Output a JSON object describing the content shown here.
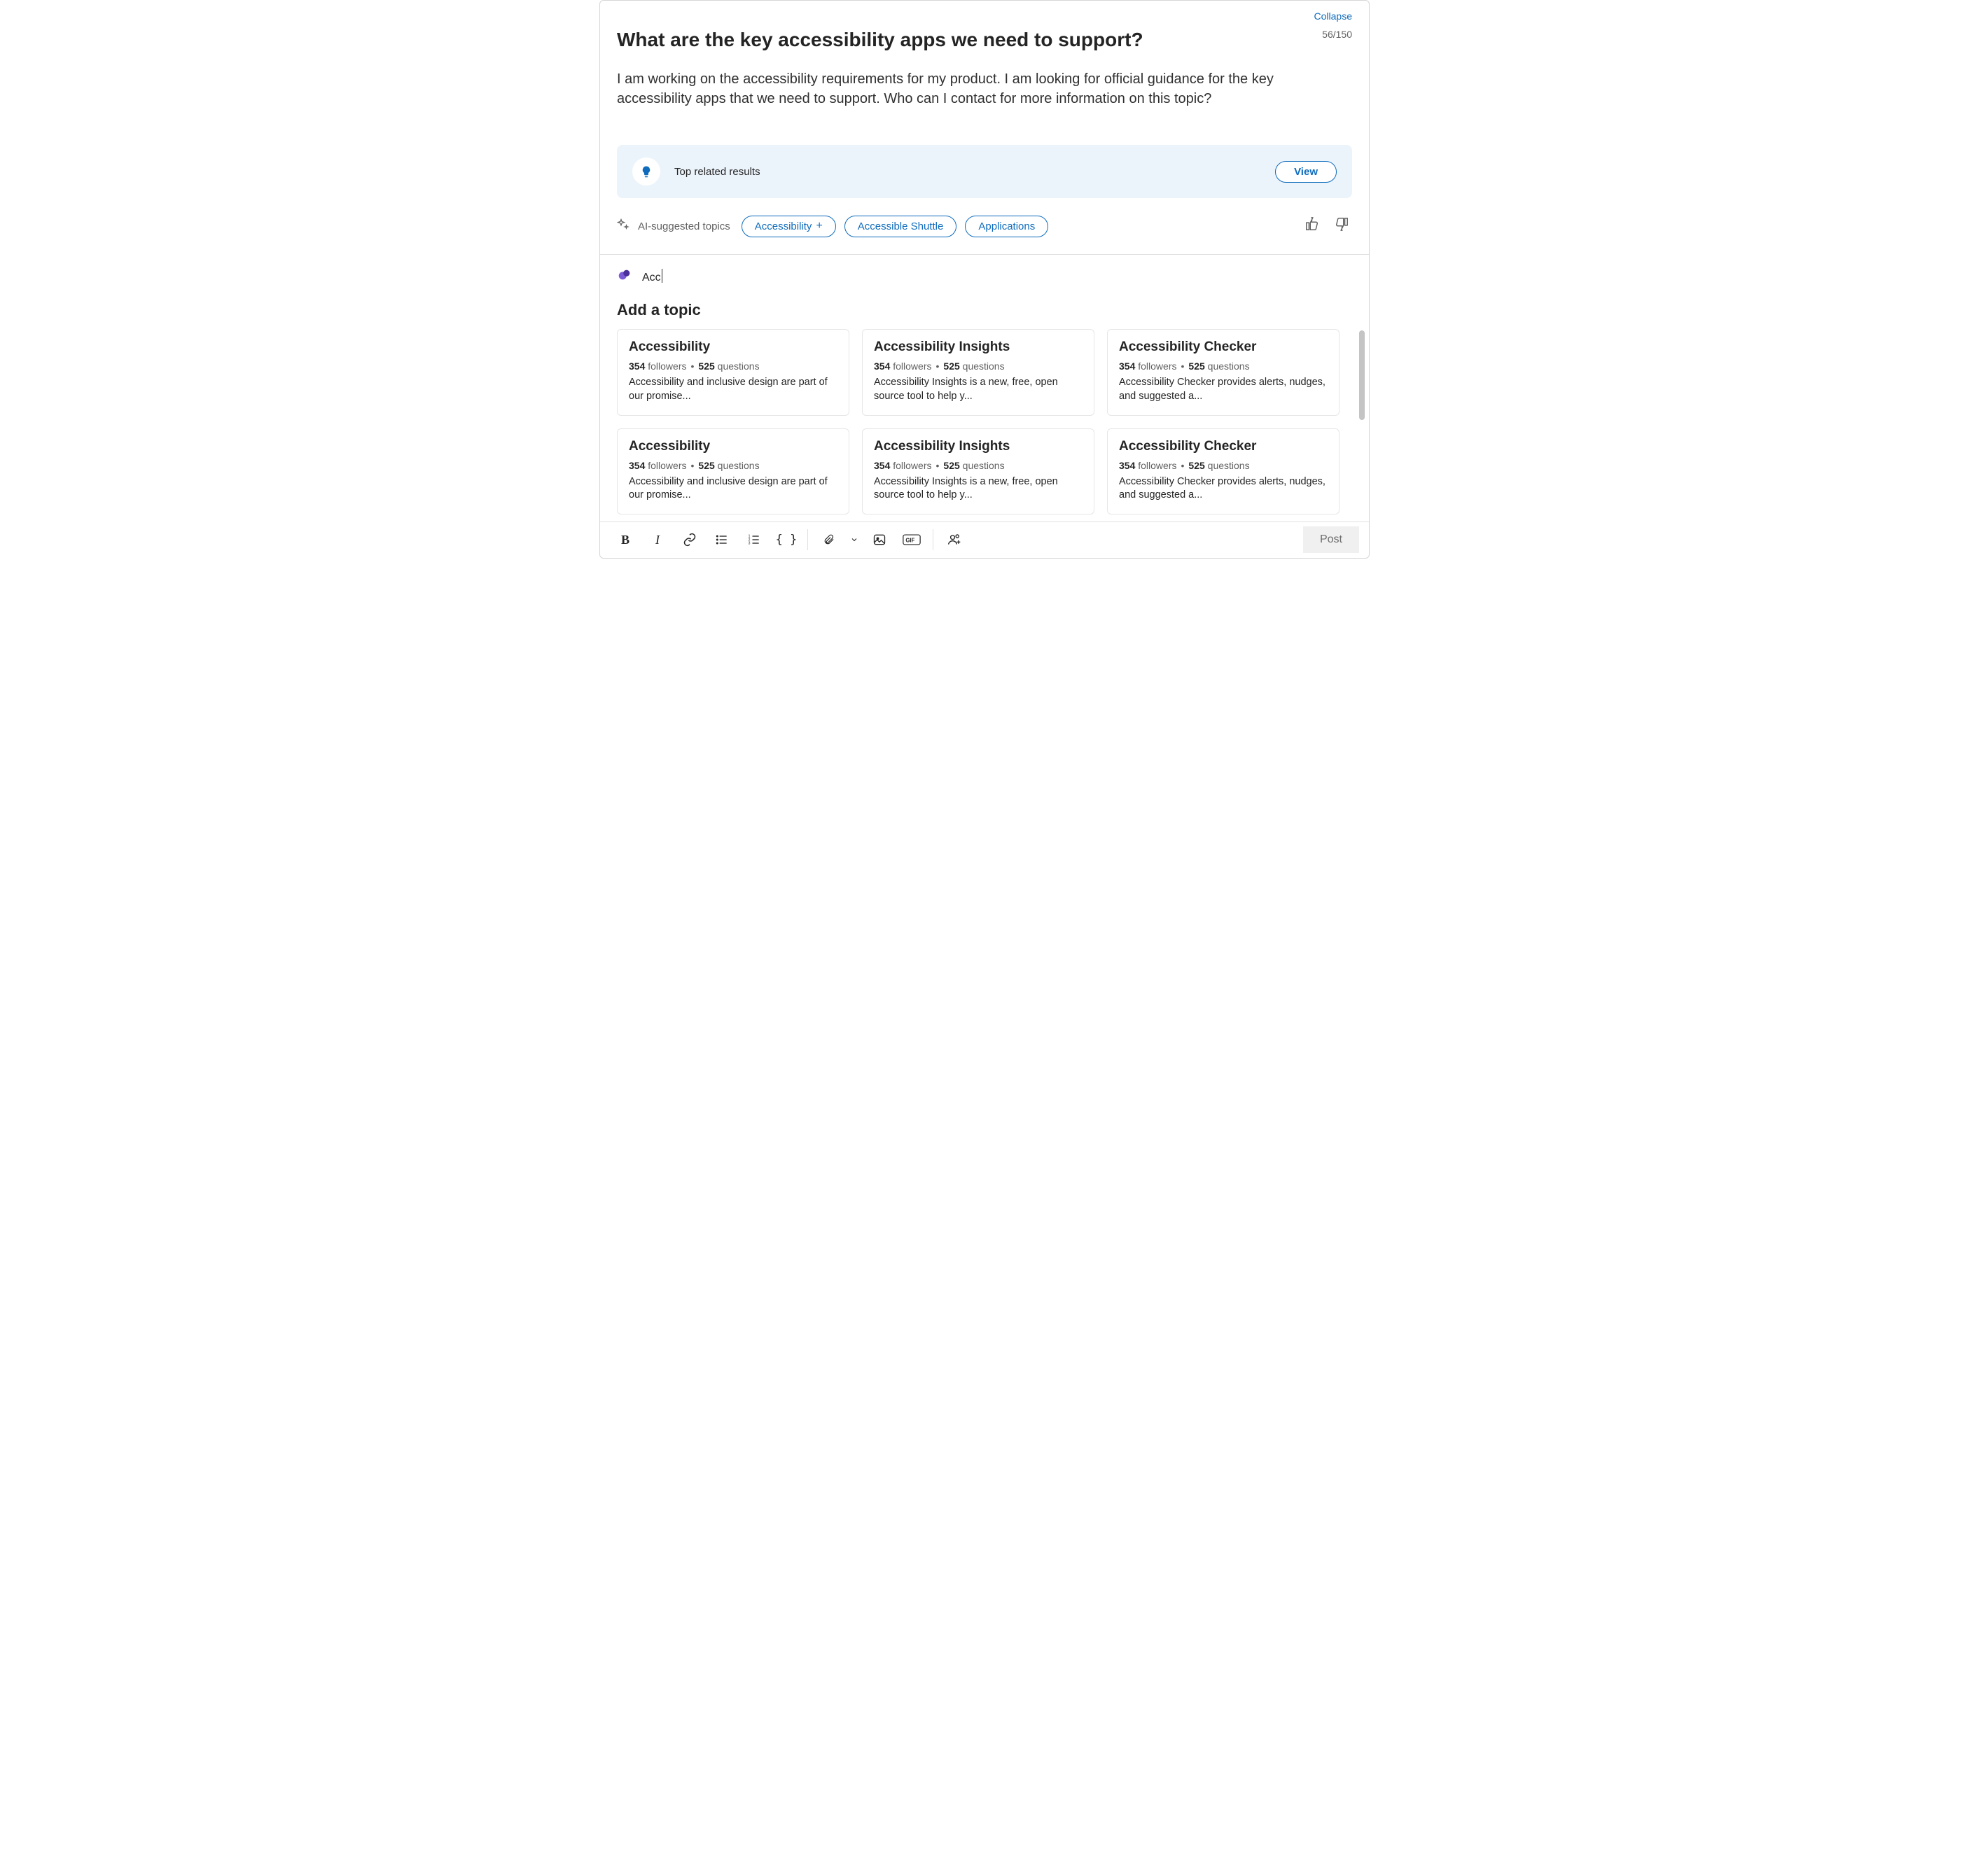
{
  "header": {
    "collapse": "Collapse",
    "title": "What are the key accessibility apps we need to support?",
    "counter": "56/150"
  },
  "body": "I am working on the accessibility requirements for my product. I am looking for official guidance for the key accessibility apps that we need to support. Who can I contact for more information on this topic?",
  "related": {
    "label": "Top related results",
    "view": "View"
  },
  "ai": {
    "label": "AI-suggested topics",
    "chips": [
      "Accessibility",
      "Accessible Shuttle",
      "Applications"
    ],
    "plus_on_first": true
  },
  "search_text": "Acc",
  "add_topic_label": "Add a topic",
  "stats": {
    "followers_num": "354",
    "followers_lbl": "followers",
    "questions_num": "525",
    "questions_lbl": "questions"
  },
  "topics": [
    {
      "title": "Accessibility",
      "desc": "Accessibility and inclusive design are part of our promise..."
    },
    {
      "title": "Accessibility Insights",
      "desc": "Accessibility Insights is a new, free, open source tool to help y..."
    },
    {
      "title": "Accessibility Checker",
      "desc": "Accessibility Checker provides alerts, nudges, and suggested a..."
    },
    {
      "title": "Accessibility",
      "desc": "Accessibility and inclusive design are part of our promise..."
    },
    {
      "title": "Accessibility Insights",
      "desc": "Accessibility Insights is a new, free, open source tool to help y..."
    },
    {
      "title": "Accessibility Checker",
      "desc": "Accessibility Checker provides alerts, nudges, and suggested a..."
    }
  ],
  "post_label": "Post"
}
